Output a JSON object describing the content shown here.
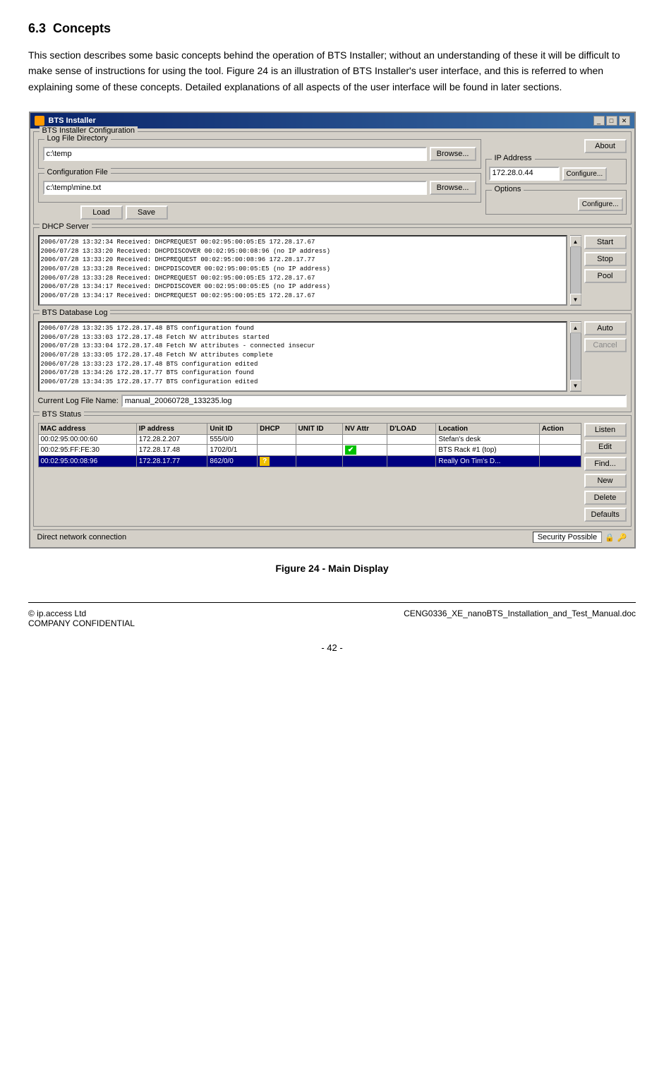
{
  "section": {
    "number": "6.3",
    "title": "Concepts"
  },
  "intro": "This section describes some basic concepts behind the operation of BTS Installer; without an understanding of these it will be difficult to make sense of instructions for using the tool. Figure 24 is an illustration of BTS Installer's user interface, and this is referred to when explaining some of these concepts. Detailed explanations of all aspects of the user interface will be found in later sections.",
  "window": {
    "title": "BTS Installer",
    "config_group": "BTS Installer Configuration",
    "log_file_dir_label": "Log File Directory",
    "log_file_dir_value": "c:\\temp",
    "config_file_label": "Configuration File",
    "config_file_value": "c:\\temp\\mine.txt",
    "browse1": "Browse...",
    "browse2": "Browse...",
    "load": "Load",
    "save": "Save",
    "about": "About",
    "ip_address_label": "IP Address",
    "ip_address_value": "172.28.0.44",
    "configure1": "Configure...",
    "options_label": "Options",
    "configure2": "Configure...",
    "dhcp_group": "DHCP Server",
    "dhcp_log": [
      "2006/07/28 13:32:34   Received: DHCPREQUEST   00:02:95:00:05:E5  172.28.17.67",
      "2006/07/28 13:33:20   Received: DHCPDISCOVER  00:02:95:00:08:96  (no IP address)",
      "2006/07/28 13:33:20   Received: DHCPREQUEST   00:02:95:00:08:96  172.28.17.77",
      "2006/07/28 13:33:28   Received: DHCPDISCOVER  00:02:95:00:05:E5  (no IP address)",
      "2006/07/28 13:33:28   Received: DHCPREQUEST   00:02:95:00:05:E5  172.28.17.67",
      "2006/07/28 13:34:17   Received: DHCPDISCOVER  00:02:95:00:05:E5  (no IP address)",
      "2006/07/28 13:34:17   Received: DHCPREQUEST   00:02:95:00:05:E5  172.28.17.67"
    ],
    "start": "Start",
    "stop": "Stop",
    "pool": "Pool",
    "bts_db_group": "BTS Database Log",
    "bts_db_log": [
      "2006/07/28 13:32:35   172.28.17.48        BTS configuration found",
      "2006/07/28 13:33:03   172.28.17.48        Fetch NV attributes started",
      "2006/07/28 13:33:04   172.28.17.48        Fetch NV attributes - connected insecur",
      "2006/07/28 13:33:05   172.28.17.48        Fetch NV attributes complete",
      "2006/07/28 13:33:23   172.28.17.48        BTS configuration edited",
      "2006/07/28 13:34:26   172.28.17.77        BTS configuration found",
      "2006/07/28 13:34:35   172.28.17.77        BTS configuration edited"
    ],
    "auto": "Auto",
    "cancel": "Cancel",
    "current_log_label": "Current Log File Name:",
    "current_log_value": "manual_20060728_133235.log",
    "bts_status_group": "BTS Status",
    "table_headers": [
      "MAC address",
      "IP address",
      "Unit ID",
      "DHCP",
      "UNIT ID",
      "NV Attr",
      "D'LOAD",
      "Location",
      "Action"
    ],
    "table_rows": [
      {
        "mac": "00:02:95:00:00:60",
        "ip": "172.28.2.207",
        "unit_id": "555/0/0",
        "dhcp": "",
        "unit_id2": "",
        "nv_attr": "",
        "dload": "",
        "location": "Stefan's desk",
        "selected": false
      },
      {
        "mac": "00:02:95:FF:FE:30",
        "ip": "172.28.17.48",
        "unit_id": "1702/0/1",
        "dhcp": "",
        "unit_id2": "",
        "nv_attr": "check",
        "dload": "",
        "location": "BTS Rack #1 (top)",
        "selected": false
      },
      {
        "mac": "00:02:95:00:08:96",
        "ip": "172.28.17.77",
        "unit_id": "862/0/0",
        "dhcp": "question",
        "unit_id2": "",
        "nv_attr": "",
        "dload": "",
        "location": "Really On Tim's D...",
        "selected": true
      }
    ],
    "listen": "Listen",
    "edit": "Edit",
    "find": "Find...",
    "new_btn": "New",
    "delete": "Delete",
    "defaults": "Defaults",
    "status_bar_text": "Direct network connection",
    "security_text": "Security Possible"
  },
  "figure_caption": "Figure 24 - Main Display",
  "footer_left": "© ip.access Ltd\nCOMPANY CONFIDENTIAL",
  "footer_right": "CENG0336_XE_nanoBTS_Installation_and_Test_Manual.doc",
  "page_number": "- 42 -"
}
